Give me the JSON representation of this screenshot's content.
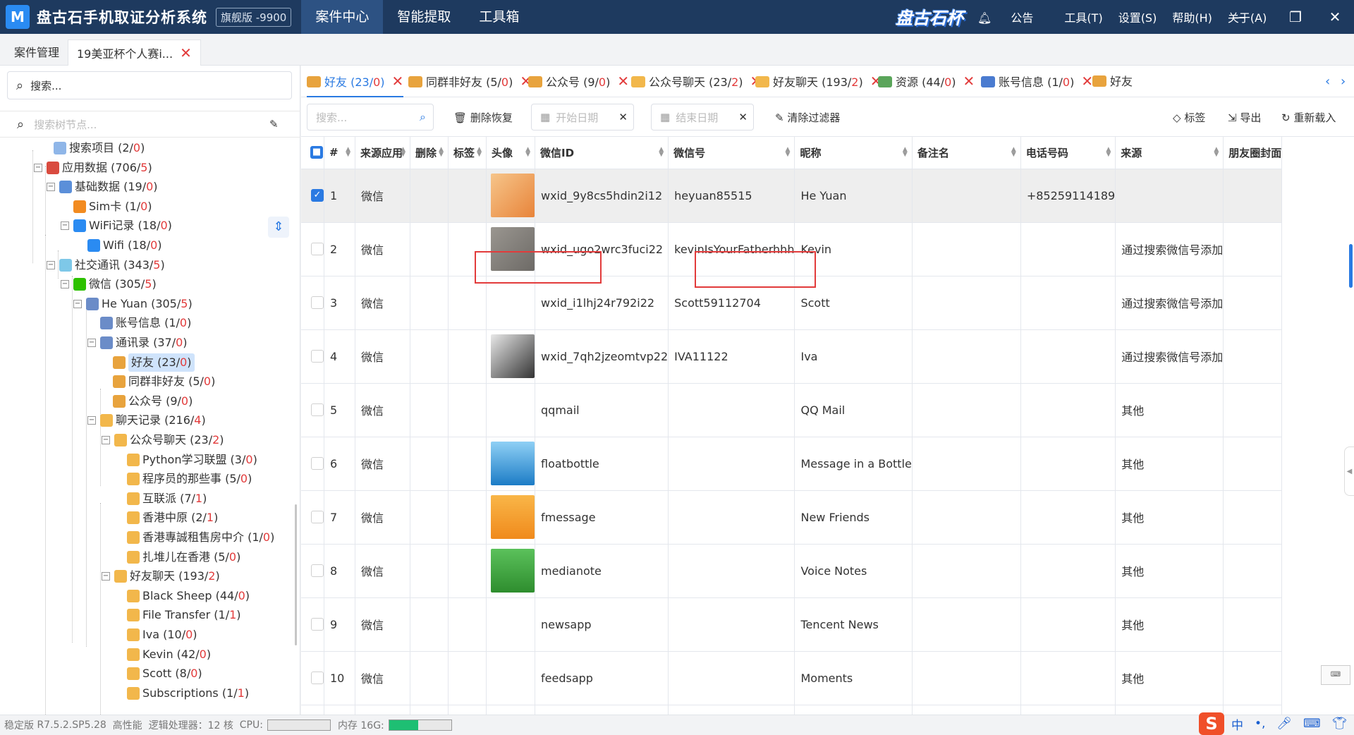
{
  "titlebar": {
    "logo": "M",
    "title": "盘古石手机取证分析系统",
    "edition": "旗舰版 -9900",
    "menu": [
      "案件中心",
      "智能提取",
      "工具箱"
    ],
    "brand": "盘古石杯",
    "right_menu": [
      "公告",
      "工具(T)",
      "设置(S)",
      "帮助(H)",
      "关于(A)"
    ]
  },
  "tabs": {
    "case_mgmt": "案件管理",
    "current": "19美亚杯个人赛i..."
  },
  "left": {
    "search_placeholder": "搜索...",
    "tree_search_placeholder": "搜索树节点...",
    "tree": [
      {
        "label": "搜索项目",
        "count": "2",
        "sub": "0",
        "icon": "search-item-icon"
      },
      {
        "label": "应用数据",
        "count": "706",
        "sub": "5",
        "icon": "app-data-icon"
      },
      {
        "label": "基础数据",
        "count": "19",
        "sub": "0",
        "icon": "basic-data-icon"
      },
      {
        "label": "Sim卡",
        "count": "1",
        "sub": "0",
        "icon": "sim-icon"
      },
      {
        "label": "WiFi记录",
        "count": "18",
        "sub": "0",
        "icon": "wifi-icon"
      },
      {
        "label": "Wifi",
        "count": "18",
        "sub": "0",
        "icon": "wifi-icon"
      },
      {
        "label": "社交通讯",
        "count": "343",
        "sub": "5",
        "icon": "social-icon"
      },
      {
        "label": "微信",
        "count": "305",
        "sub": "5",
        "icon": "wechat-icon"
      },
      {
        "label": "He Yuan",
        "count": "305",
        "sub": "5",
        "icon": "user-icon"
      },
      {
        "label": "账号信息",
        "count": "1",
        "sub": "0",
        "icon": "account-icon"
      },
      {
        "label": "通讯录",
        "count": "37",
        "sub": "0",
        "icon": "contacts-icon"
      },
      {
        "label": "好友",
        "count": "23",
        "sub": "0",
        "icon": "friends-icon"
      },
      {
        "label": "同群非好友",
        "count": "5",
        "sub": "0",
        "icon": "friends-icon"
      },
      {
        "label": "公众号",
        "count": "9",
        "sub": "0",
        "icon": "friends-icon"
      },
      {
        "label": "聊天记录",
        "count": "216",
        "sub": "4",
        "icon": "chat-icon"
      },
      {
        "label": "公众号聊天",
        "count": "23",
        "sub": "2",
        "icon": "chat-icon"
      },
      {
        "label": "Python学习联盟",
        "count": "3",
        "sub": "0",
        "icon": "chat-icon"
      },
      {
        "label": "程序员的那些事",
        "count": "5",
        "sub": "0",
        "icon": "chat-icon"
      },
      {
        "label": "互联派",
        "count": "7",
        "sub": "1",
        "icon": "chat-icon"
      },
      {
        "label": "香港中原",
        "count": "2",
        "sub": "1",
        "icon": "chat-icon"
      },
      {
        "label": "香港專誠租售房中介",
        "count": "1",
        "sub": "0",
        "icon": "chat-icon"
      },
      {
        "label": "扎堆儿在香港",
        "count": "5",
        "sub": "0",
        "icon": "chat-icon"
      },
      {
        "label": "好友聊天",
        "count": "193",
        "sub": "2",
        "icon": "chat-icon"
      },
      {
        "label": "Black Sheep",
        "count": "44",
        "sub": "0",
        "icon": "chat-icon"
      },
      {
        "label": "File Transfer",
        "count": "1",
        "sub": "1",
        "icon": "chat-icon"
      },
      {
        "label": "Iva",
        "count": "10",
        "sub": "0",
        "icon": "chat-icon"
      },
      {
        "label": "Kevin",
        "count": "42",
        "sub": "0",
        "icon": "chat-icon"
      },
      {
        "label": "Scott",
        "count": "8",
        "sub": "0",
        "icon": "chat-icon"
      },
      {
        "label": "Subscriptions",
        "count": "1",
        "sub": "1",
        "icon": "chat-icon"
      }
    ]
  },
  "subtabs": [
    {
      "label": "好友",
      "count": "23",
      "sub": "0"
    },
    {
      "label": "同群非好友",
      "count": "5",
      "sub": "0"
    },
    {
      "label": "公众号",
      "count": "9",
      "sub": "0"
    },
    {
      "label": "公众号聊天",
      "count": "23",
      "sub": "2"
    },
    {
      "label": "好友聊天",
      "count": "193",
      "sub": "2"
    },
    {
      "label": "资源",
      "count": "44",
      "sub": "0"
    },
    {
      "label": "账号信息",
      "count": "1",
      "sub": "0"
    },
    {
      "label": "好友",
      "count": "",
      "sub": ""
    }
  ],
  "toolbar": {
    "search_placeholder": "搜索...",
    "delete_restore": "删除恢复",
    "start_date": "开始日期",
    "end_date": "结束日期",
    "clear_filter": "清除过滤器",
    "tag": "标签",
    "export": "导出",
    "reload": "重新载入"
  },
  "table": {
    "columns": [
      "#",
      "来源应用",
      "删除",
      "标签",
      "头像",
      "微信ID",
      "微信号",
      "昵称",
      "备注名",
      "电话号码",
      "来源",
      "朋友圈封面"
    ],
    "rows": [
      {
        "n": "1",
        "app": "微信",
        "avatar": "orange-fox-avatar",
        "wxid": "wxid_9y8cs5hdin2i12",
        "wxno": "heyuan85515",
        "nick": "He Yuan",
        "remark": "",
        "phone": "+85259114189",
        "source": ""
      },
      {
        "n": "2",
        "app": "微信",
        "avatar": "gray-texture-avatar",
        "wxid": "wxid_ugo2wrc3fuci22",
        "wxno": "kevinIsYourFatherhhh",
        "nick": "Kevin",
        "remark": "",
        "phone": "",
        "source": "通过搜索微信号添加"
      },
      {
        "n": "3",
        "app": "微信",
        "avatar": "",
        "wxid": "wxid_i1lhj24r792i22",
        "wxno": "Scott59112704",
        "nick": "Scott",
        "remark": "",
        "phone": "",
        "source": "通过搜索微信号添加"
      },
      {
        "n": "4",
        "app": "微信",
        "avatar": "bw-portrait-avatar",
        "wxid": "wxid_7qh2jzeomtvp22",
        "wxno": "IVA11122",
        "nick": "Iva",
        "remark": "",
        "phone": "",
        "source": "通过搜索微信号添加"
      },
      {
        "n": "5",
        "app": "微信",
        "avatar": "",
        "wxid": "qqmail",
        "wxno": "",
        "nick": "QQ Mail",
        "remark": "",
        "phone": "",
        "source": "其他"
      },
      {
        "n": "6",
        "app": "微信",
        "avatar": "bottle-avatar",
        "wxid": "floatbottle",
        "wxno": "",
        "nick": "Message in a Bottle",
        "remark": "",
        "phone": "",
        "source": "其他"
      },
      {
        "n": "7",
        "app": "微信",
        "avatar": "friends-avatar",
        "wxid": "fmessage",
        "wxno": "",
        "nick": "New Friends",
        "remark": "",
        "phone": "",
        "source": "其他"
      },
      {
        "n": "8",
        "app": "微信",
        "avatar": "note-avatar",
        "wxid": "medianote",
        "wxno": "",
        "nick": "Voice Notes",
        "remark": "",
        "phone": "",
        "source": "其他"
      },
      {
        "n": "9",
        "app": "微信",
        "avatar": "",
        "wxid": "newsapp",
        "wxno": "",
        "nick": "Tencent News",
        "remark": "",
        "phone": "",
        "source": "其他"
      },
      {
        "n": "10",
        "app": "微信",
        "avatar": "",
        "wxid": "feedsapp",
        "wxno": "",
        "nick": "Moments",
        "remark": "",
        "phone": "",
        "source": "其他"
      },
      {
        "n": "",
        "app": "",
        "avatar": "",
        "wxid": "",
        "wxno": "",
        "nick": "",
        "remark": "",
        "phone": "",
        "source": ""
      }
    ]
  },
  "status": {
    "version": "稳定版",
    "build": "R7.5.2.SP5.28",
    "perf": "高性能",
    "cpu_cores": "逻辑处理器：12 核",
    "cpu": "CPU:",
    "mem": "内存 16G:",
    "mem_used_fraction": 0.47
  },
  "ime": [
    "S",
    "中",
    "•,",
    "mic",
    "keyboard",
    "shirt",
    "grid"
  ],
  "colors": {
    "titlebar": "#1e3a5f",
    "accent": "#2a7ae2",
    "red": "#e23b3b",
    "mem": "#1ebf73"
  }
}
